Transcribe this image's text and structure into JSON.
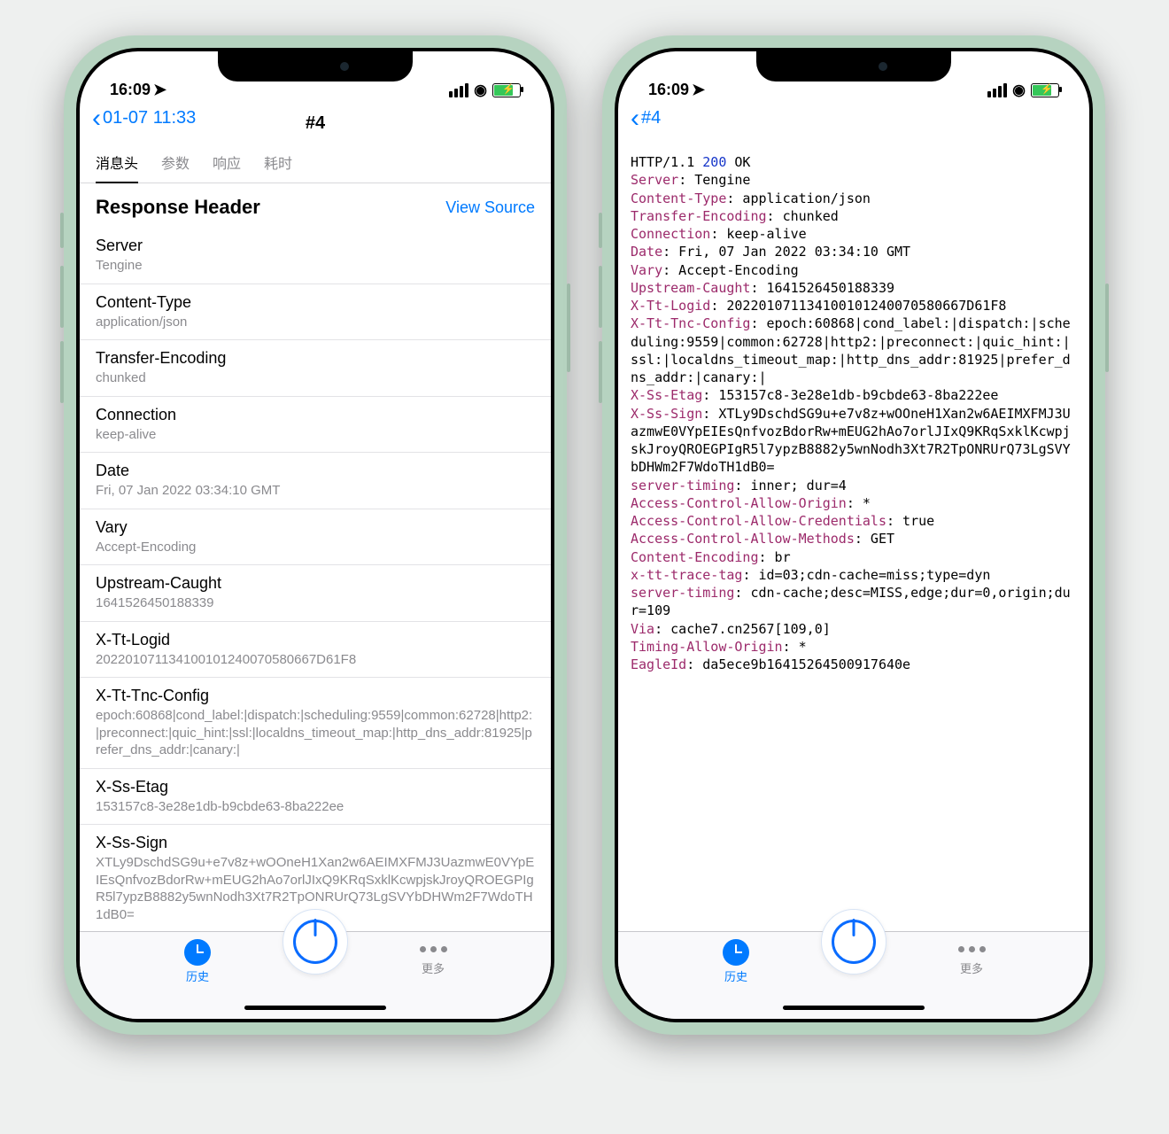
{
  "status": {
    "time": "16:09",
    "location_icon": "◤"
  },
  "left": {
    "back_label": "01-07 11:33",
    "nav_title": "#4",
    "tabs": [
      "消息头",
      "参数",
      "响应",
      "耗时"
    ],
    "active_tab": 0,
    "section_title": "Response Header",
    "view_source": "View Source",
    "headers": [
      {
        "k": "Server",
        "v": "Tengine"
      },
      {
        "k": "Content-Type",
        "v": "application/json"
      },
      {
        "k": "Transfer-Encoding",
        "v": "chunked"
      },
      {
        "k": "Connection",
        "v": "keep-alive"
      },
      {
        "k": "Date",
        "v": "Fri, 07 Jan 2022 03:34:10 GMT"
      },
      {
        "k": "Vary",
        "v": "Accept-Encoding"
      },
      {
        "k": "Upstream-Caught",
        "v": "1641526450188339"
      },
      {
        "k": "X-Tt-Logid",
        "v": "202201071134100101240070580667D61F8"
      },
      {
        "k": "X-Tt-Tnc-Config",
        "v": "epoch:60868|cond_label:|dispatch:|scheduling:9559|common:62728|http2:|preconnect:|quic_hint:|ssl:|localdns_timeout_map:|http_dns_addr:81925|prefer_dns_addr:|canary:|"
      },
      {
        "k": "X-Ss-Etag",
        "v": "153157c8-3e28e1db-b9cbde63-8ba222ee"
      },
      {
        "k": "X-Ss-Sign",
        "v": "XTLy9DschdSG9u+e7v8z+wOOneH1Xan2w6AEIMXFMJ3UazmwE0VYpEIEsQnfvozBdorRw+mEUG2hAo7orlJIxQ9KRqSxklKcwpjskJroyQROEGPIgR5l7ypzB8882y5wnNodh3Xt7R2TpONRUrQ73LgSVYbDHWm2F7WdoTH1dB0="
      }
    ]
  },
  "right": {
    "back_label": "#4",
    "raw": [
      {
        "pre": "HTTP/1.1 ",
        "status": "200",
        "post": " OK"
      },
      {
        "k": "Server",
        "v": "Tengine"
      },
      {
        "k": "Content-Type",
        "v": "application/json"
      },
      {
        "k": "Transfer-Encoding",
        "v": "chunked"
      },
      {
        "k": "Connection",
        "v": "keep-alive"
      },
      {
        "k": "Date",
        "v": "Fri, 07 Jan 2022 03:34:10 GMT"
      },
      {
        "k": "Vary",
        "v": "Accept-Encoding"
      },
      {
        "k": "Upstream-Caught",
        "v": "1641526450188339"
      },
      {
        "k": "X-Tt-Logid",
        "v": "202201071134100101240070580667D61F8"
      },
      {
        "k": "X-Tt-Tnc-Config",
        "v": "epoch:60868|cond_label:|dispatch:|scheduling:9559|common:62728|http2:|preconnect:|quic_hint:|ssl:|localdns_timeout_map:|http_dns_addr:81925|prefer_dns_addr:|canary:|"
      },
      {
        "k": "X-Ss-Etag",
        "v": "153157c8-3e28e1db-b9cbde63-8ba222ee"
      },
      {
        "k": "X-Ss-Sign",
        "v": "XTLy9DschdSG9u+e7v8z+wOOneH1Xan2w6AEIMXFMJ3UazmwE0VYpEIEsQnfvozBdorRw+mEUG2hAo7orlJIxQ9KRqSxklKcwpjskJroyQROEGPIgR5l7ypzB8882y5wnNodh3Xt7R2TpONRUrQ73LgSVYbDHWm2F7WdoTH1dB0="
      },
      {
        "k": "server-timing",
        "v": "inner; dur=4"
      },
      {
        "k": "Access-Control-Allow-Origin",
        "v": "*"
      },
      {
        "k": "Access-Control-Allow-Credentials",
        "v": "true"
      },
      {
        "k": "Access-Control-Allow-Methods",
        "v": "GET"
      },
      {
        "k": "Content-Encoding",
        "v": "br"
      },
      {
        "k": "x-tt-trace-tag",
        "v": "id=03;cdn-cache=miss;type=dyn"
      },
      {
        "k": "server-timing",
        "v": "cdn-cache;desc=MISS,edge;dur=0,origin;dur=109"
      },
      {
        "k": "Via",
        "v": "cache7.cn2567[109,0]"
      },
      {
        "k": "Timing-Allow-Origin",
        "v": "*"
      },
      {
        "k": "EagleId",
        "v": "da5ece9b16415264500917640e"
      }
    ]
  },
  "tabbar": {
    "history": "历史",
    "more": "更多"
  }
}
